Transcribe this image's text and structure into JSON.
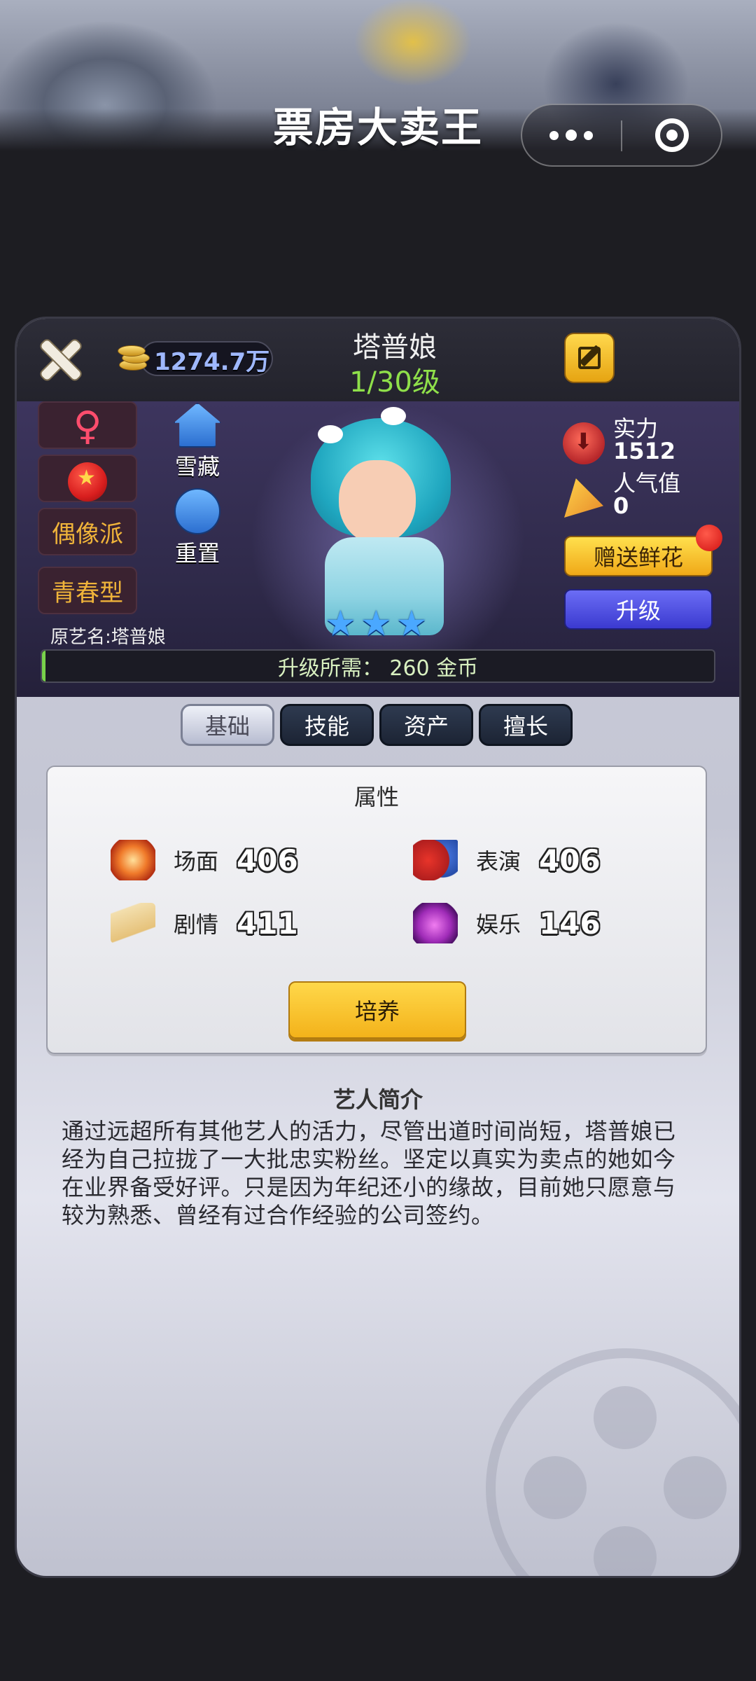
{
  "app": {
    "title": "票房大卖王",
    "capsule_more_icon": "more-dots-icon",
    "capsule_close_icon": "close-circle-icon"
  },
  "header": {
    "coins": "1274.7万",
    "artist_name": "塔普娘",
    "level": "1/30级"
  },
  "profile": {
    "gender_symbol": "♀",
    "tags": [
      "偶像派",
      "青春型"
    ],
    "actions": [
      {
        "label": "雪藏",
        "icon": "house-icon"
      },
      {
        "label": "重置",
        "icon": "refresh-icon"
      }
    ],
    "stage_name": "原艺名:塔普娘",
    "stars": [
      "★",
      "★",
      "★"
    ],
    "power_label": "实力",
    "power_value": "1512",
    "popularity_label": "人气值",
    "popularity_value": "0",
    "send_flowers": "赠送鲜花",
    "upgrade": "升级",
    "upgrade_requirement": "升级所需： 260  金币",
    "upgrade_progress": 0
  },
  "tabs": [
    {
      "label": "基础",
      "active": true
    },
    {
      "label": "技能",
      "active": false
    },
    {
      "label": "资产",
      "active": false
    },
    {
      "label": "擅长",
      "active": false
    }
  ],
  "attributes": {
    "title": "属性",
    "items": [
      {
        "label": "场面",
        "value": "406",
        "icon": "explosion-icon"
      },
      {
        "label": "表演",
        "value": "406",
        "icon": "theater-masks-icon"
      },
      {
        "label": "剧情",
        "value": "411",
        "icon": "book-icon"
      },
      {
        "label": "娱乐",
        "value": "146",
        "icon": "disco-ball-icon"
      }
    ],
    "train_button": "培养"
  },
  "intro": {
    "title": "艺人简介",
    "text": "通过远超所有其他艺人的活力，尽管出道时间尚短，塔普娘已经为自己拉拢了一大批忠实粉丝。坚定以真实为卖点的她如今在业界备受好评。只是因为年纪还小的缘故，目前她只愿意与较为熟悉、曾经有过合作经验的公司签约。"
  },
  "colors": {
    "level_green": "#8fe04a",
    "coin_blue": "#9fb8ff",
    "tag_gold": "#f0b43a",
    "button_yellow": "#ffd84a",
    "button_blue": "#4b4ddf"
  }
}
